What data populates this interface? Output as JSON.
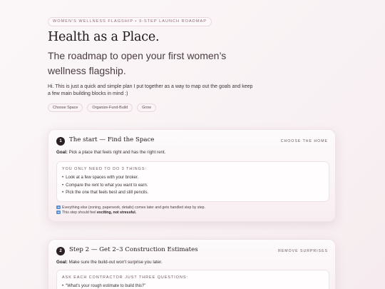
{
  "header": {
    "eyebrow": "WOMEN'S WELLNESS FLAGSHIP • 9-STEP LAUNCH ROADMAP",
    "title": "Health as a Place.",
    "subtitle": "The roadmap to open your first women’s wellness flagship.",
    "intro": "Hi. This is just a quick and simple plan I put together as a way to map out the goals and keep a few main building blocks in mind :)"
  },
  "chips": [
    "Choose Space",
    "Organize-Fund-Build",
    "Grow"
  ],
  "steps": [
    {
      "number": "1",
      "title": "The start — Find the Space",
      "tag": "CHOOSE THE HOME",
      "goal_label": "Goal:",
      "goal_text": "Pick a place that feels right and has the right rent.",
      "box_heading": "YOU ONLY NEED TO DO 3 THINGS:",
      "bullets": [
        "Look at a few spaces with your broker.",
        "Compare the rent to what you want to earn.",
        "Pick the one that feels best and still pencils."
      ],
      "notes": [
        "Everything else (zoning, paperwork, details) comes later and gets handled step by step.",
        "This step should feel",
        "exciting, not stressful."
      ]
    },
    {
      "number": "2",
      "title": "Step 2 — Get 2–3 Construction Estimates",
      "tag": "REMOVE SURPRISES",
      "goal_label": "Goal:",
      "goal_text": "Make sure the build-out won't surprise you later.",
      "box_heading": "ASK EACH CONTRACTOR JUST THREE QUESTIONS:",
      "bullets": [
        "“What’s your rough estimate to build this?”"
      ]
    }
  ],
  "icons": {
    "note_icon": "arrow-right-icon",
    "note_icon_color": "#5b8fd6"
  },
  "colors": {
    "accent": "#2a1f23",
    "chip_border": "#e9d8dd",
    "background": "#f9f2f4"
  }
}
